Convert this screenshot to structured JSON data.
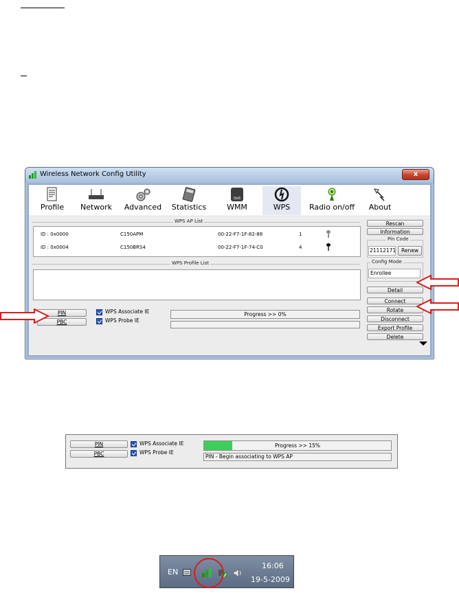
{
  "window": {
    "title": "Wireless Network Config Utility",
    "close_label": "x",
    "toolbar": [
      {
        "label": "Profile",
        "icon": "profile-icon"
      },
      {
        "label": "Network",
        "icon": "network-icon"
      },
      {
        "label": "Advanced",
        "icon": "advanced-icon"
      },
      {
        "label": "Statistics",
        "icon": "statistics-icon"
      },
      {
        "label": "WMM",
        "icon": "wmm-icon"
      },
      {
        "label": "WPS",
        "icon": "wps-icon"
      },
      {
        "label": "Radio on/off",
        "icon": "radio-icon"
      },
      {
        "label": "About",
        "icon": "about-icon"
      }
    ],
    "wmm_badge": "QoS",
    "ap_list_title": "WPS AP List",
    "ap_rows": [
      {
        "id": "ID : 0x0000",
        "ssid": "C150APM",
        "mac": "00-22-F7-1F-82-88",
        "ch": "1"
      },
      {
        "id": "ID : 0x0004",
        "ssid": "C150BRS4",
        "mac": "00-22-F7-1F-74-C0",
        "ch": "4"
      }
    ],
    "profile_list_title": "WPS Profile List",
    "pin_label": "PIN",
    "pbc_label": "PBC",
    "assoc_ie_label": "WPS Associate IE",
    "probe_ie_label": "WPS Probe IE",
    "progress_text": "Progress >> 0%",
    "side": {
      "rescan": "Rescan",
      "information": "Information",
      "pin_code_title": "Pin Code",
      "pin_code_value": "21112171",
      "renew": "Renew",
      "config_mode_title": "Config Mode",
      "config_mode_value": "Enrollee",
      "detail": "Detail",
      "connect": "Connect",
      "rotate": "Rotate",
      "disconnect": "Disconnect",
      "export_profile": "Export Profile",
      "delete": "Delete"
    }
  },
  "panel2": {
    "pin_label": "PIN",
    "pbc_label": "PBC",
    "assoc_ie_label": "WPS Associate IE",
    "probe_ie_label": "WPS Probe IE",
    "progress_text": "Progress >> 15%",
    "progress_value": 0.15,
    "status_text": "PIN - Begin associating to WPS AP"
  },
  "taskbar": {
    "lang": "EN",
    "time": "16:06",
    "date": "19-5-2009"
  },
  "colors": {
    "progress_fill": "#3ecf5a",
    "arrow": "#d81d1d",
    "circle": "#d81d1d"
  }
}
